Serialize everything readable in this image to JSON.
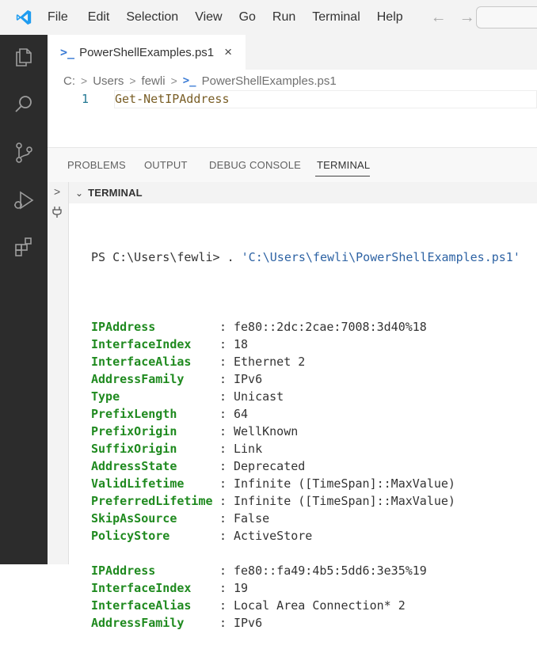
{
  "menubar": {
    "items": [
      "File",
      "Edit",
      "Selection",
      "View",
      "Go",
      "Run",
      "Terminal",
      "Help"
    ],
    "back_icon": "arrow-left-icon",
    "forward_icon": "arrow-right-icon"
  },
  "activity_bar": {
    "icons": [
      "explorer-icon",
      "search-icon",
      "source-control-icon",
      "run-debug-icon",
      "extensions-icon"
    ]
  },
  "editor": {
    "tab_label": "PowerShellExamples.ps1",
    "tab_close": "×",
    "breadcrumb": [
      "C:",
      "Users",
      "fewli",
      "PowerShellExamples.ps1"
    ],
    "line_number": "1",
    "line_code": "Get-NetIPAddress"
  },
  "panel": {
    "tabs": [
      "PROBLEMS",
      "OUTPUT",
      "DEBUG CONSOLE",
      "TERMINAL"
    ],
    "active_tab": "TERMINAL",
    "section_title": "TERMINAL"
  },
  "terminal": {
    "prompt": "PS C:\\Users\\fewli> ",
    "command_dot": ". ",
    "command_path": "'C:\\Users\\fewli\\PowerShellExamples.ps1'",
    "blocks": [
      [
        {
          "name": "IPAddress",
          "value": "fe80::2dc:2cae:7008:3d40%18"
        },
        {
          "name": "InterfaceIndex",
          "value": "18"
        },
        {
          "name": "InterfaceAlias",
          "value": "Ethernet 2"
        },
        {
          "name": "AddressFamily",
          "value": "IPv6"
        },
        {
          "name": "Type",
          "value": "Unicast"
        },
        {
          "name": "PrefixLength",
          "value": "64"
        },
        {
          "name": "PrefixOrigin",
          "value": "WellKnown"
        },
        {
          "name": "SuffixOrigin",
          "value": "Link"
        },
        {
          "name": "AddressState",
          "value": "Deprecated"
        },
        {
          "name": "ValidLifetime",
          "value": "Infinite ([TimeSpan]::MaxValue)"
        },
        {
          "name": "PreferredLifetime",
          "value": "Infinite ([TimeSpan]::MaxValue)"
        },
        {
          "name": "SkipAsSource",
          "value": "False"
        },
        {
          "name": "PolicyStore",
          "value": "ActiveStore"
        }
      ],
      [
        {
          "name": "IPAddress",
          "value": "fe80::fa49:4b5:5dd6:3e35%19"
        },
        {
          "name": "InterfaceIndex",
          "value": "19"
        },
        {
          "name": "InterfaceAlias",
          "value": "Local Area Connection* 2"
        },
        {
          "name": "AddressFamily",
          "value": "IPv6"
        }
      ]
    ]
  },
  "colors": {
    "activity_bar": "#2c2c2c",
    "property_name": "#1f8a1f",
    "string": "#2e63a4",
    "accent": "#3a7bd5"
  }
}
